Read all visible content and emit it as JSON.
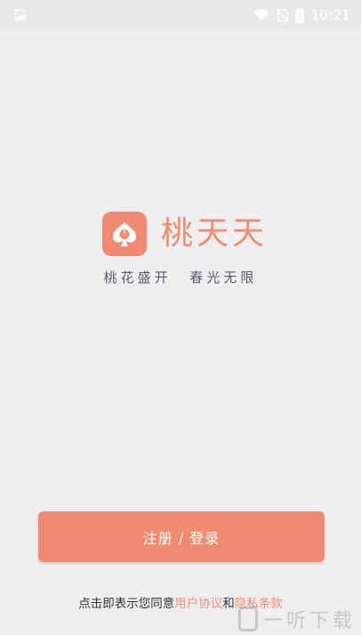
{
  "status_bar": {
    "time": "10:21",
    "icons": [
      "image-icon",
      "wifi-icon",
      "no-sim-icon",
      "battery-charging-icon"
    ]
  },
  "app": {
    "name": "桃天天",
    "slogan_left": "桃花盛开",
    "slogan_right": "春光无限",
    "icon": "spade-peach-icon",
    "brand_color": "#f08b72"
  },
  "main_button": {
    "label": "注册 / 登录"
  },
  "agreement": {
    "prefix": "点击即表示您同意",
    "user_agreement": "用户协议",
    "conjunction": "和",
    "privacy_policy": "隐私条款"
  },
  "watermark": {
    "text": "一听下载"
  }
}
